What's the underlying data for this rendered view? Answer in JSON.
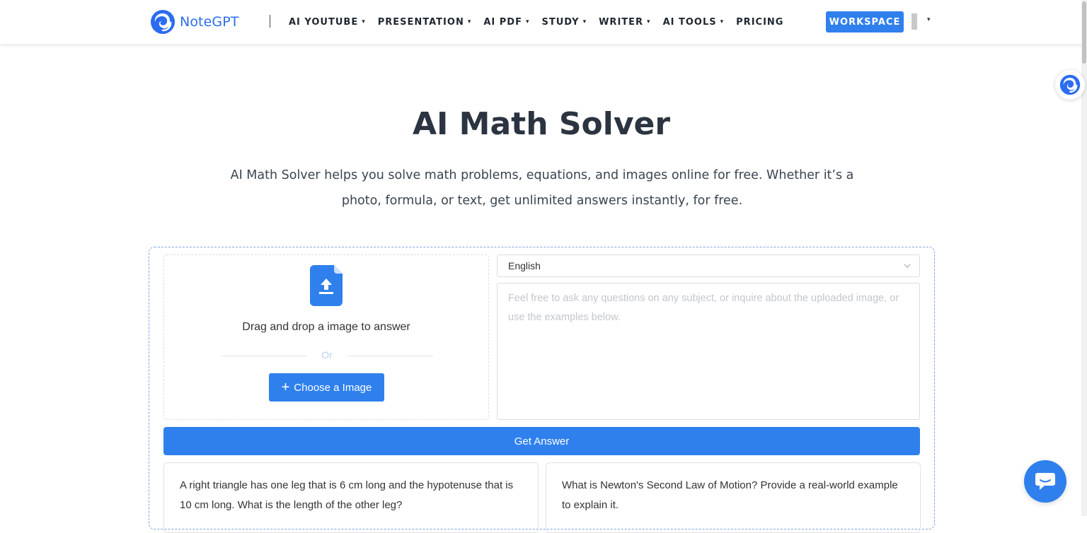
{
  "brand": {
    "name": "NoteGPT",
    "color": "#2b6cf0",
    "icon": "notegpt-logo-icon"
  },
  "nav": {
    "items": [
      {
        "label": "AI YOUTUBE",
        "dropdown": true
      },
      {
        "label": "PRESENTATION",
        "dropdown": true
      },
      {
        "label": "AI PDF",
        "dropdown": true
      },
      {
        "label": "STUDY",
        "dropdown": true
      },
      {
        "label": "WRITER",
        "dropdown": true
      },
      {
        "label": "AI TOOLS",
        "dropdown": true
      },
      {
        "label": "PRICING",
        "dropdown": false
      }
    ],
    "workspace_label": "WORKSPACE",
    "dropdown_glyph": "▾"
  },
  "hero": {
    "title": "AI Math Solver",
    "subtitle": "AI Math Solver helps you solve math problems, equations, and images online for free. Whether it’s a photo, formula, or text, get unlimited answers instantly, for free."
  },
  "upload": {
    "icon": "file-upload-icon",
    "drag_text": "Drag and drop a image to answer",
    "or_text": "Or",
    "choose_plus": "+",
    "choose_label": "Choose a Image"
  },
  "language": {
    "selected": "English",
    "icon": "chevron-down-icon"
  },
  "question": {
    "value": "",
    "placeholder": "Feel free to ask any questions on any subject, or inquire about the uploaded image, or use the examples below."
  },
  "actions": {
    "get_answer_label": "Get Answer"
  },
  "examples": [
    "A right triangle has one leg that is 6 cm long and the hypotenuse that is 10 cm long. What is the length of the other leg?",
    "What is Newton's Second Law of Motion? Provide a real-world example to explain it."
  ],
  "chat": {
    "icon": "chat-bubble-icon"
  },
  "colors": {
    "accent": "#2f80ed",
    "text": "#2b3440",
    "border": "#dcdcdc"
  }
}
